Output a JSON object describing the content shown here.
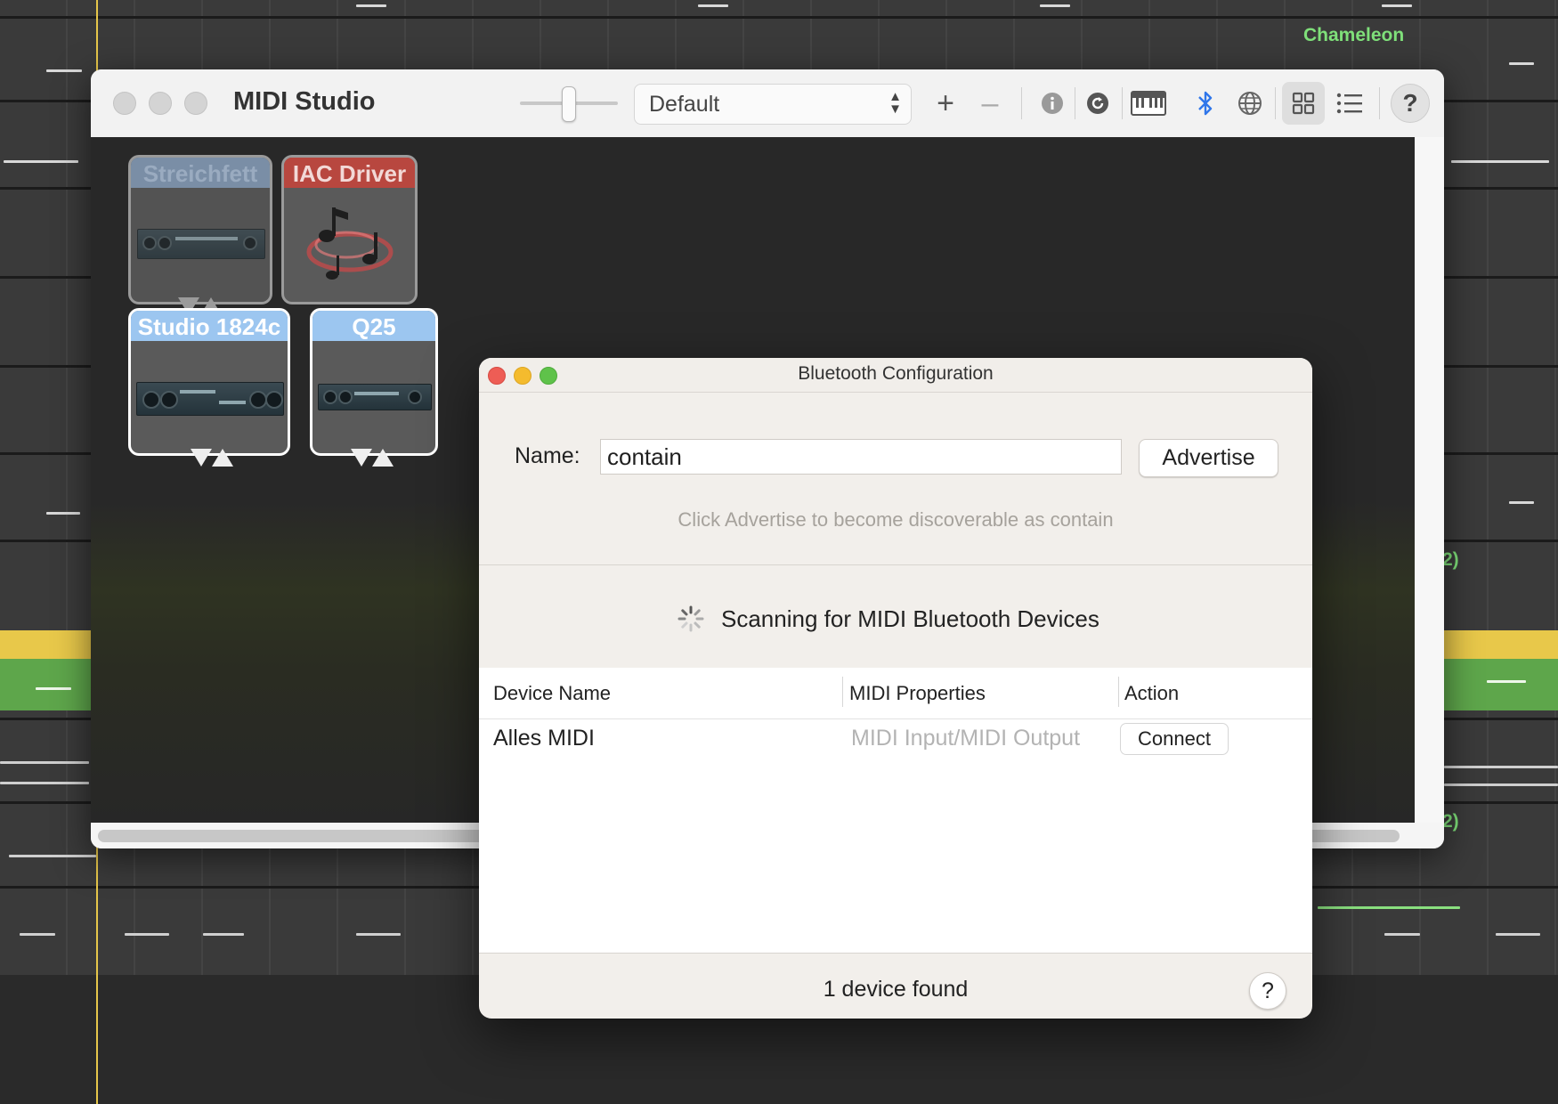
{
  "background": {
    "track_label": "Chameleon",
    "region_label_1": "2)",
    "region_label_2": "2)"
  },
  "midi_studio": {
    "title": "MIDI Studio",
    "configuration": "Default",
    "toolbar_icons": [
      "add-icon",
      "remove-icon",
      "info-icon",
      "rescan-icon",
      "keyboard-icon",
      "bluetooth-icon",
      "network-icon",
      "grid-view-icon",
      "list-view-icon",
      "help-icon"
    ],
    "devices": [
      {
        "name": "Streichfett",
        "header_color": "#7a8ea6",
        "text_color": "#9aabc0",
        "selected": false
      },
      {
        "name": "IAC Driver",
        "header_color": "#b8473f",
        "text_color": "#f2d9d7",
        "selected": false
      },
      {
        "name": "Studio 1824c",
        "header_color": "#9cc6f0",
        "text_color": "#ffffff",
        "selected": true
      },
      {
        "name": "Q25",
        "header_color": "#9cc6f0",
        "text_color": "#ffffff",
        "selected": true
      }
    ]
  },
  "bluetooth": {
    "title": "Bluetooth Configuration",
    "name_label": "Name:",
    "name_value": "contain",
    "advertise_label": "Advertise",
    "hint": "Click Advertise to become discoverable as contain",
    "scan_status": "Scanning for MIDI Bluetooth Devices",
    "columns": [
      "Device Name",
      "MIDI Properties",
      "Action"
    ],
    "rows": [
      {
        "device": "Alles MIDI",
        "properties": "MIDI Input/MIDI Output",
        "action": "Connect"
      }
    ],
    "footer": "1 device found",
    "help": "?"
  },
  "colors": {
    "close": "#ee5d55",
    "minimize": "#f4bb2e",
    "zoom": "#5fc24a",
    "bluetooth_accent": "#2f76ea",
    "track_label_green": "#7fe07a"
  }
}
